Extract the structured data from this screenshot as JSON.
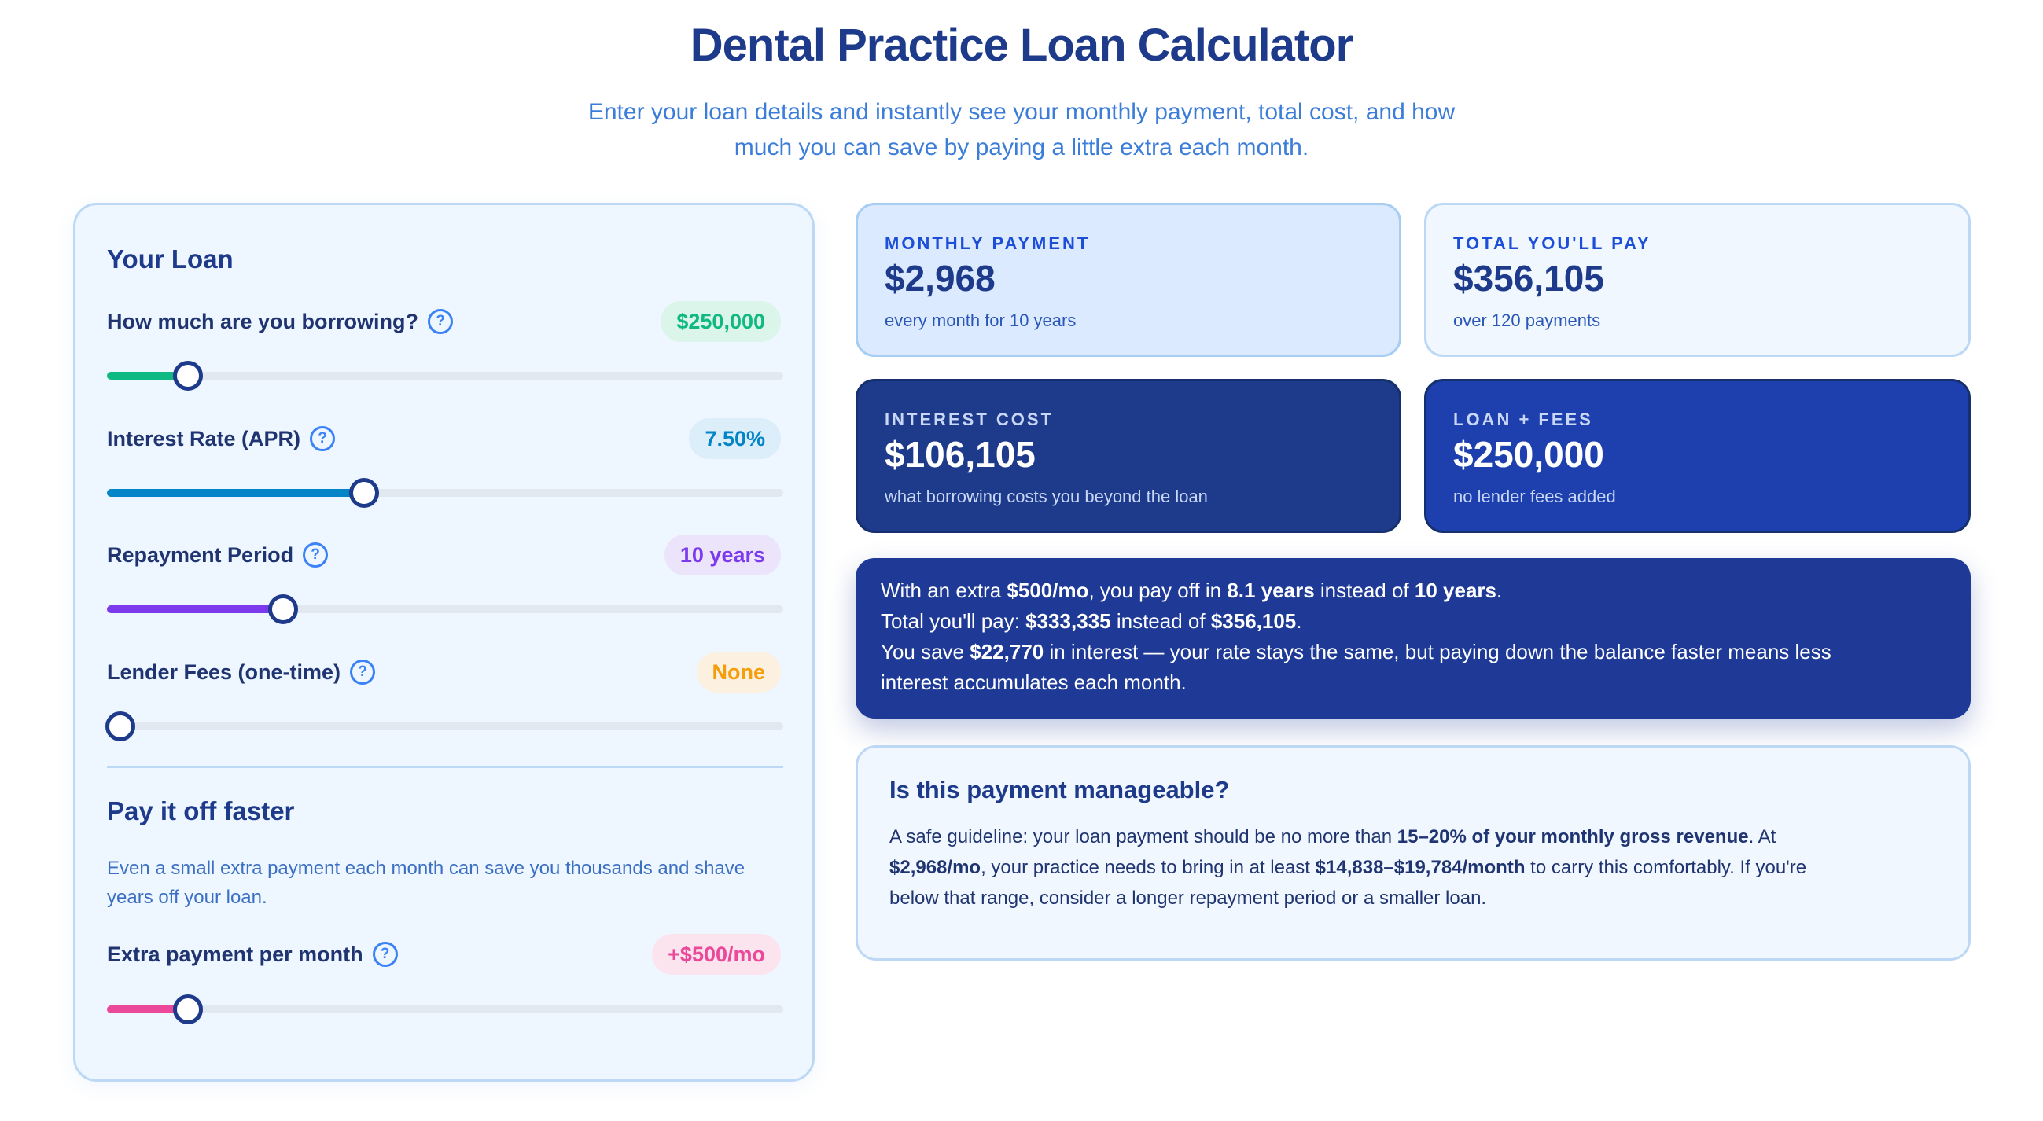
{
  "header": {
    "title": "Dental Practice Loan Calculator",
    "subtitle_line1": "Enter your loan details and instantly see your monthly payment, total cost, and how",
    "subtitle_line2": "much you can save by paying a little extra each month."
  },
  "colors": {
    "primary_dark": "#1e3a8a",
    "accent_blue": "#3b82f6",
    "amount_green": "#10b981",
    "rate_blue": "#0284c7",
    "period_purple": "#7c3aed",
    "fees_orange": "#f59e0b",
    "extra_pink": "#ec4899"
  },
  "loan_panel": {
    "heading": "Your Loan",
    "help_glyph": "?",
    "fields": [
      {
        "label": "How much are you borrowing?",
        "value": "$250,000",
        "fraction": 0.12
      },
      {
        "label": "Interest Rate (APR)",
        "value": "7.50%",
        "fraction": 0.38
      },
      {
        "label": "Repayment Period",
        "value": "10 years",
        "fraction": 0.26
      },
      {
        "label": "Lender Fees (one-time)",
        "value": "None",
        "fraction": 0.02
      }
    ],
    "faster": {
      "heading": "Pay it off faster",
      "hint_line1": "Even a small extra payment each month can save you thousands and shave",
      "hint_line2": "years off your loan.",
      "label": "Extra payment per month",
      "value": "+$500/mo",
      "fraction": 0.12
    }
  },
  "cards": {
    "monthly": {
      "label": "Monthly Payment",
      "value": "$2,968",
      "sub": "every month for 10 years"
    },
    "total": {
      "label": "Total You'll Pay",
      "value": "$356,105",
      "sub": "over 120 payments"
    },
    "interest": {
      "label": "Interest Cost",
      "value": "$106,105",
      "sub": "what borrowing costs you beyond the loan"
    },
    "fees": {
      "label": "Loan + Fees",
      "value": "$250,000",
      "sub": "no lender fees added"
    }
  },
  "savings": {
    "l1_a": "With an extra ",
    "l1_b": "$500/mo",
    "l1_c": ", you pay off in ",
    "l1_d": "8.1 years",
    "l1_e": " instead of ",
    "l1_f": "10 years",
    "l1_g": ".",
    "l2_a": "Total you'll pay: ",
    "l2_b": "$333,335",
    "l2_c": " instead of ",
    "l2_d": "$356,105",
    "l2_e": ".",
    "l3_a": "You save ",
    "l3_b": "$22,770",
    "l3_c": " in interest — your rate stays the same, but paying down the balance faster means less",
    "l4": "interest accumulates each month."
  },
  "manageable": {
    "heading": "Is this payment manageable?",
    "p_a": "A safe guideline: your loan payment should be no more than ",
    "p_b": "15–20% of your monthly gross revenue",
    "p_c": ". At",
    "p_d": "$2,968/mo",
    "p_e": ", your practice needs to bring in at least ",
    "p_f": "$14,838–$19,784/month",
    "p_g": " to carry this comfortably. If you're",
    "p_h": "below that range, consider a longer repayment period or a smaller loan."
  }
}
